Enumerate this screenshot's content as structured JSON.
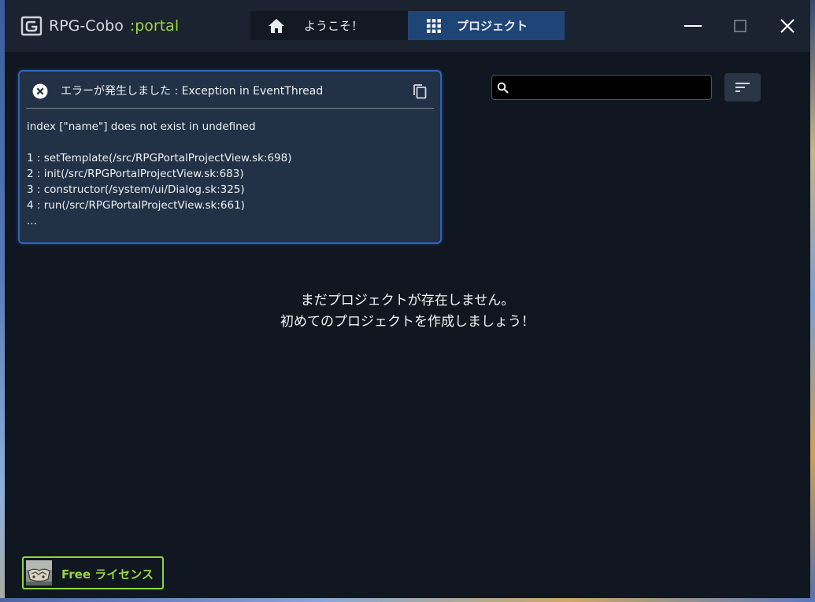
{
  "app": {
    "name": "RPG-Cobo",
    "suffix": ":portal"
  },
  "tabs": [
    {
      "label": "ようこそ！",
      "icon": "home-icon",
      "active": false
    },
    {
      "label": "プロジェクト",
      "icon": "grid-icon",
      "active": true
    }
  ],
  "window_controls": {
    "minimize": "minimize-icon",
    "maximize": "maximize-icon",
    "close": "close-icon"
  },
  "error": {
    "title": "エラーが発生しました : Exception in EventThread",
    "icon": "error-circle-icon",
    "copy_icon": "copy-icon",
    "lines": [
      "index [\"name\"] does not exist in undefined",
      "",
      "1 : setTemplate(/src/RPGPortalProjectView.sk:698)",
      "2 : init(/src/RPGPortalProjectView.sk:683)",
      "3 : constructor(/system/ui/Dialog.sk:325)",
      "4 : run(/src/RPGPortalProjectView.sk:661)",
      "..."
    ]
  },
  "search": {
    "icon": "search-icon",
    "value": "",
    "placeholder": ""
  },
  "sort": {
    "icon": "sort-icon"
  },
  "empty_state": {
    "line1": "まだプロジェクトが存在しません。",
    "line2": "初めてのプロジェクトを作成しましょう！"
  },
  "license": {
    "label": "Free ライセンス"
  },
  "colors": {
    "accent_green": "#9bd641",
    "active_tab": "#1f4577",
    "window_bg": "#111720",
    "titlebar_bg": "#1b2230",
    "error_border": "#2d64b8"
  }
}
